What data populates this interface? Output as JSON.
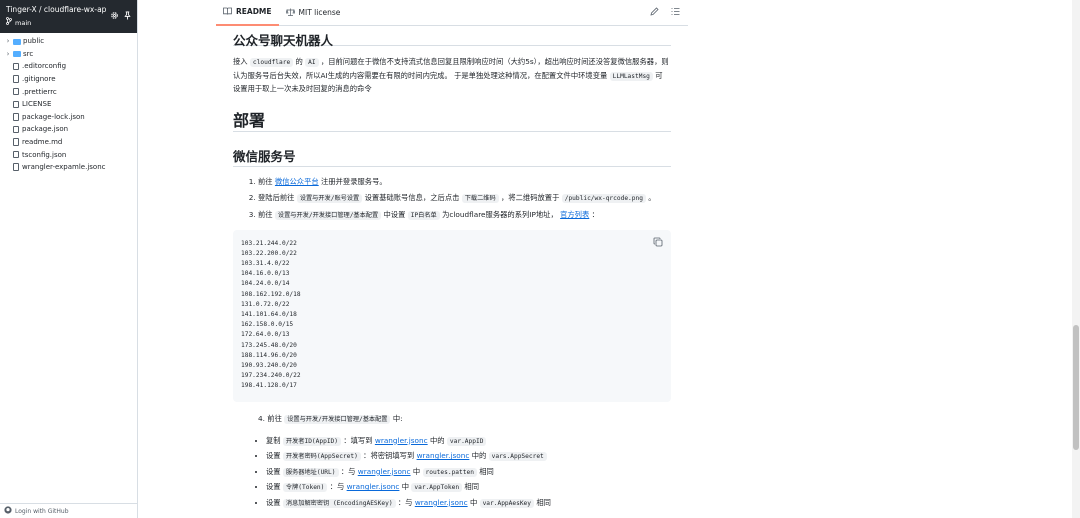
{
  "sidebar": {
    "repo_title": "Tinger-X / cloudflare-wx-ap",
    "branch": "main",
    "items": [
      {
        "label": "public",
        "type": "folder"
      },
      {
        "label": "src",
        "type": "folder"
      },
      {
        "label": ".editorconfig",
        "type": "file"
      },
      {
        "label": ".gitignore",
        "type": "file"
      },
      {
        "label": ".prettierrc",
        "type": "file"
      },
      {
        "label": "LICENSE",
        "type": "file"
      },
      {
        "label": "package-lock.json",
        "type": "file"
      },
      {
        "label": "package.json",
        "type": "file"
      },
      {
        "label": "readme.md",
        "type": "file"
      },
      {
        "label": "tsconfig.json",
        "type": "file"
      },
      {
        "label": "wrangler-expamle.jsonc",
        "type": "file"
      }
    ],
    "login": "Login with GitHub"
  },
  "tabs": {
    "readme": "README",
    "license": "MIT license"
  },
  "readme": {
    "heading_bot": "公众号聊天机器人",
    "intro": {
      "t1": "接入",
      "c1": "cloudflare",
      "t2": "的",
      "c2": "AI",
      "t3": "，目前问题在于微信不支持流式信息回复且限制响应时间（大约5s），超出响应时间还没答复微信服务器，则认为服务号后台失效，所以AI生成的内容需要在有限的时间内完成。 于是单独处理这种情况，在配置文件中环境变量",
      "c3": "LLMLastMsg",
      "t4": "可设置用于取上一次未及时回复的消息的命令"
    },
    "heading_deploy": "部署",
    "heading_wx": "微信服务号",
    "step1": {
      "t1": "前往",
      "link": "微信公众平台",
      "t2": "注册并登录服务号。"
    },
    "step2": {
      "t1": "登陆后前往",
      "c1": "设置与开发/账号设置",
      "t2": "设置基础账号信息，之后点击",
      "c2": "下载二维码",
      "t3": "，将二维码放置于",
      "c3": "/public/wx-qrcode.png",
      "t4": "。"
    },
    "step3": {
      "t1": "前往",
      "c1": "设置与开发/开发接口管理/基本配置",
      "t2": "中设置",
      "c2": "IP白名单",
      "t3": "为cloudflare服务器的系列IP地址，",
      "link": "官方列表",
      "t4": "："
    },
    "ip_list": [
      "103.21.244.0/22",
      "103.22.200.0/22",
      "103.31.4.0/22",
      "104.16.0.0/13",
      "104.24.0.0/14",
      "108.162.192.0/18",
      "131.0.72.0/22",
      "141.101.64.0/18",
      "162.158.0.0/15",
      "172.64.0.0/13",
      "173.245.48.0/20",
      "188.114.96.0/20",
      "190.93.240.0/20",
      "197.234.240.0/22",
      "198.41.128.0/17"
    ],
    "step4": {
      "num": "4.",
      "t1": "前往",
      "c1": "设置与开发/开发接口管理/基本配置",
      "t2": "中:"
    },
    "bullets": [
      {
        "t1": "复制",
        "c1": "开发者ID(AppID)",
        "t2": "：填写到",
        "link": "wrangler.jsonc",
        "t3": "中的",
        "c2": "var.AppID",
        "t4": ""
      },
      {
        "t1": "设置",
        "c1": "开发者密码(AppSecret)",
        "t2": "：将密钥填写到",
        "link": "wrangler.jsonc",
        "t3": "中的",
        "c2": "vars.AppSecret",
        "t4": ""
      },
      {
        "t1": "设置",
        "c1": "服务器地址(URL)",
        "t2": "：与",
        "link": "wrangler.jsonc",
        "t3": "中",
        "c2": "routes.patten",
        "t4": "相同"
      },
      {
        "t1": "设置",
        "c1": "令牌(Token)",
        "t2": "：与",
        "link": "wrangler.jsonc",
        "t3": "中",
        "c2": "var.AppToken",
        "t4": "相同"
      },
      {
        "t1": "设置",
        "c1": "消息加解密密钥 (EncodingAESKey)",
        "t2": "：与",
        "link": "wrangler.jsonc",
        "t3": "中",
        "c2": "var.AppAesKey",
        "t4": "相同"
      }
    ]
  },
  "colors": {
    "sidebar_header": "#24292f",
    "link": "#0969da",
    "folder": "#54aeff",
    "active_tab": "#fd8c73"
  }
}
